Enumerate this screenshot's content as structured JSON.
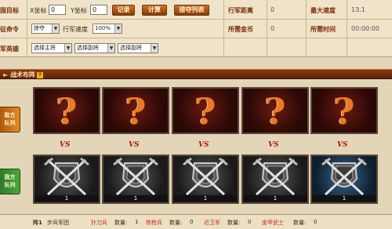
{
  "top": {
    "row1": {
      "target_label": "国目标",
      "x_label": "X坐标",
      "x_value": "0",
      "y_label": "Y坐标",
      "y_value": "0",
      "btn_record": "记录",
      "btn_calc": "计算",
      "btn_plunder": "掠夺列表",
      "distance_label": "行军距离",
      "distance_value": "0",
      "max_speed_label": "最大速度",
      "max_speed_value": "13.1"
    },
    "row2": {
      "command_label": "征命令",
      "command_select": "掠夺",
      "speed_label": "行军速度",
      "speed_select": "100%",
      "gold_label": "所需金币",
      "gold_value": "0",
      "time_label": "所需时间",
      "time_value": "00:00:00"
    },
    "row3": {
      "hero_label": "军英雄",
      "select_main": "选择主将",
      "select_sub1": "选择副将",
      "select_sub2": "选择副将"
    }
  },
  "section": {
    "title": "战术布阵",
    "badge": "?"
  },
  "enemy": {
    "tag_line1": "敌方",
    "tag_line2": "队列",
    "cards": [
      {
        "mark": "?"
      },
      {
        "mark": "?"
      },
      {
        "mark": "?"
      },
      {
        "mark": "?"
      },
      {
        "mark": "?"
      }
    ],
    "vs": "VS"
  },
  "mine": {
    "tag_line1": "我方",
    "tag_line2": "队列",
    "cards": [
      {
        "level": "1"
      },
      {
        "level": "1"
      },
      {
        "level": "1"
      },
      {
        "level": "1"
      },
      {
        "level": "1"
      }
    ]
  },
  "footer": {
    "formation_label": "阵1",
    "formation_name": "步兵军团",
    "units": [
      {
        "name": "扑刀兵",
        "count_label": "数量:",
        "count": "1"
      },
      {
        "name": "铁枪兵",
        "count_label": "数量:",
        "count": "0"
      },
      {
        "name": "近卫军",
        "count_label": "数量:",
        "count": "0"
      },
      {
        "name": "金甲武士",
        "count_label": "数量:",
        "count": "0"
      }
    ]
  },
  "colors": {
    "accent_red": "#b01808",
    "section_bar": "#7a2e0e",
    "enemy_tag": "#d07a1a",
    "mine_tag": "#3a8a30"
  }
}
